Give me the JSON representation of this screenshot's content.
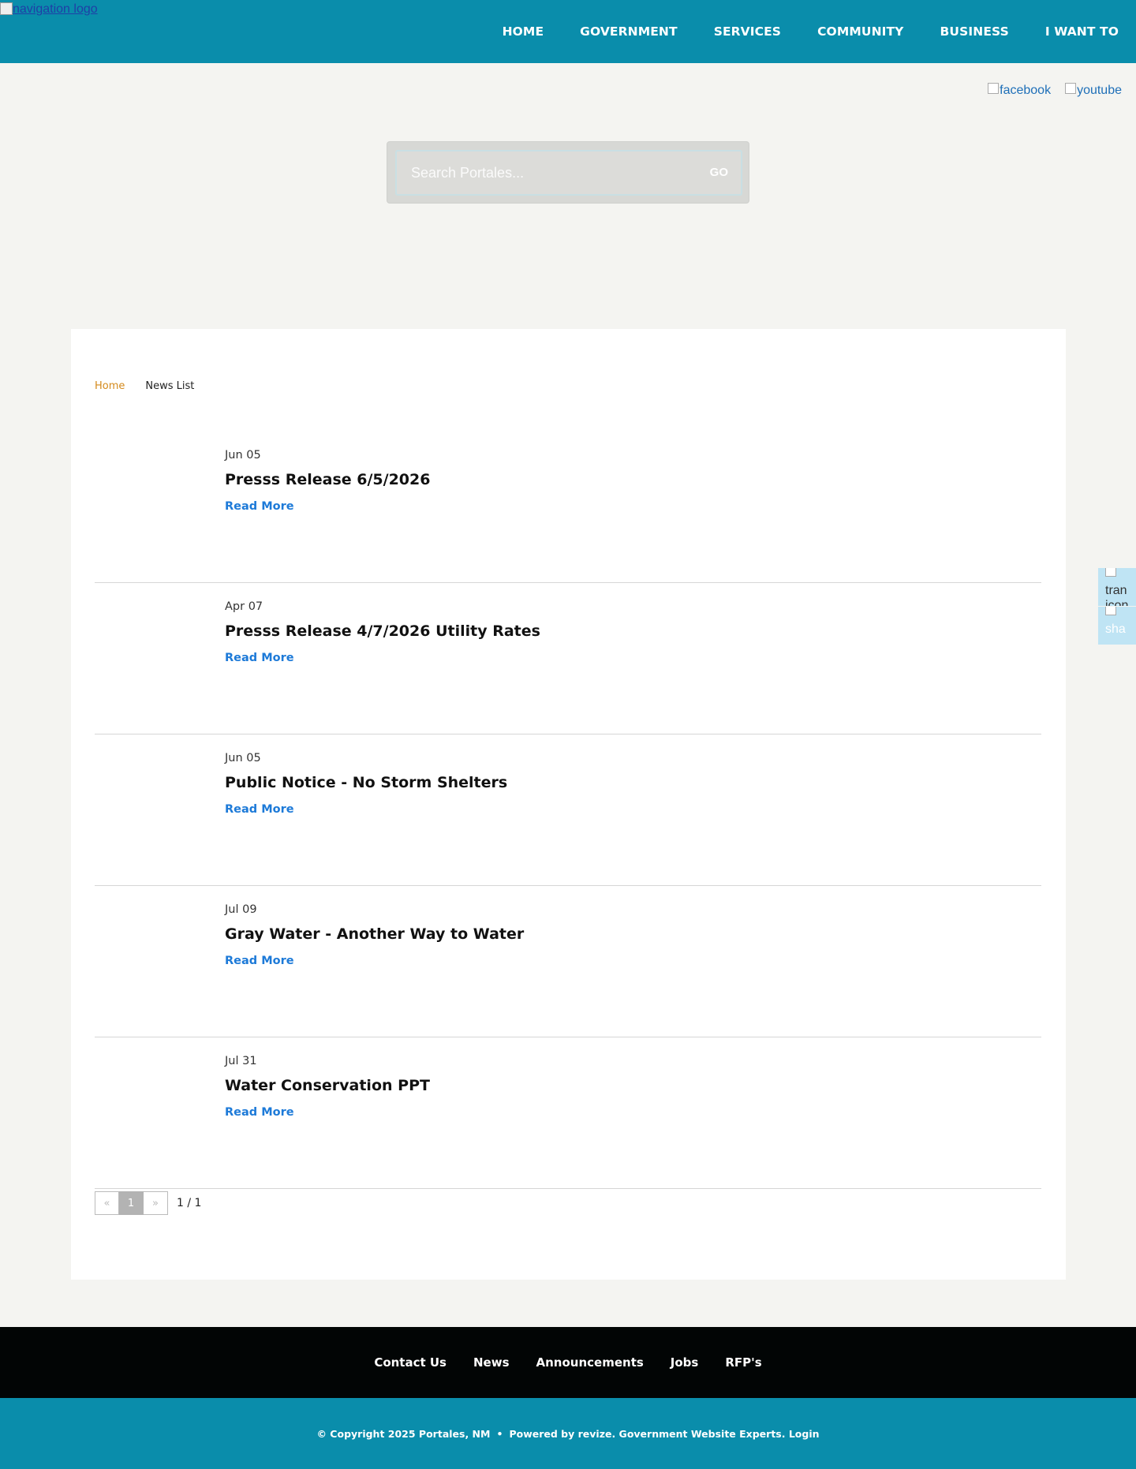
{
  "header": {
    "logo_alt": "navigation logo",
    "nav": [
      "HOME",
      "GOVERNMENT",
      "SERVICES",
      "COMMUNITY",
      "BUSINESS",
      "I WANT TO"
    ]
  },
  "social": {
    "facebook": "facebook",
    "youtube": "youtube"
  },
  "search": {
    "placeholder": "Search Portales...",
    "button": "GO"
  },
  "breadcrumb": {
    "home": "Home",
    "current": "News List"
  },
  "news": [
    {
      "date": "Jun 05",
      "title": "Presss Release 6/5/2026",
      "more": "Read More"
    },
    {
      "date": "Apr 07",
      "title": "Presss Release 4/7/2026 Utility Rates",
      "more": "Read More"
    },
    {
      "date": "Jun 05",
      "title": "Public Notice - No Storm Shelters",
      "more": "Read More"
    },
    {
      "date": "Jul 09",
      "title": "Gray Water - Another Way to Water",
      "more": "Read More"
    },
    {
      "date": "Jul 31",
      "title": "Water Conservation PPT",
      "more": "Read More"
    }
  ],
  "pager": {
    "prev": "«",
    "page": "1",
    "next": "»",
    "count": "1 / 1"
  },
  "side_tools": {
    "translate": "tran icon",
    "share": "sha"
  },
  "footer": {
    "links": [
      "Contact Us",
      "News",
      "Announcements",
      "Jobs",
      "RFP's"
    ],
    "copyright": "© Copyright 2025 Portales, NM",
    "separator": "•",
    "powered": "Powered by revize. Government Website Experts.",
    "login": "Login"
  },
  "colors": {
    "brand_teal": "#0a8dab",
    "breadcrumb_home": "#d48a1c",
    "link_blue": "#1d7ad8",
    "footer_black": "#020505"
  }
}
